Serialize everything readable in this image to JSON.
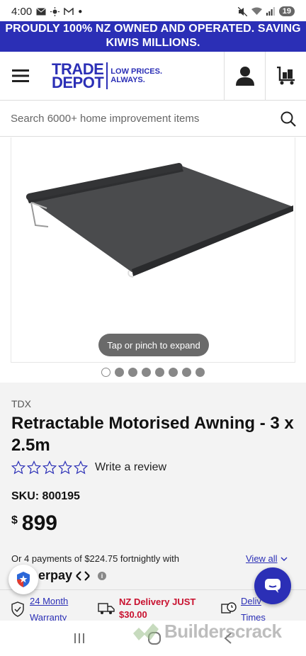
{
  "status_bar": {
    "time": "4:00",
    "battery": "19"
  },
  "promo_banner": "PROUDLY 100% NZ OWNED AND OPERATED. SAVING KIWIS MILLIONS.",
  "header": {
    "logo_line1": "TRADE",
    "logo_line2": "DEPOT",
    "tagline_line1": "LOW PRICES.",
    "tagline_line2": "ALWAYS."
  },
  "search": {
    "placeholder": "Search 6000+ home improvement items"
  },
  "gallery": {
    "expand_hint": "Tap or pinch to expand",
    "image_count": 8,
    "active_index": 0
  },
  "product": {
    "brand": "TDX",
    "title": "Retractable Motorised Awning - 3 x 2.5m",
    "rating_stars": 0,
    "review_label": "Write a review",
    "sku": "SKU: 800195",
    "currency": "$",
    "price": "899"
  },
  "afterpay": {
    "text": "Or 4 payments of $224.75 fortnightly with",
    "view_all": "View all",
    "logo_text": "erpay"
  },
  "perks": {
    "warranty_line1": "24 Month",
    "warranty_line2": "Warranty",
    "delivery_line1": "NZ Delivery JUST",
    "delivery_line2": "$30.00",
    "times_line1": "Deliv",
    "times_line2": "Times"
  },
  "watermark": "Builderscrack",
  "colors": {
    "brand_blue": "#2b2fb6",
    "delivery_red": "#c8102e"
  }
}
